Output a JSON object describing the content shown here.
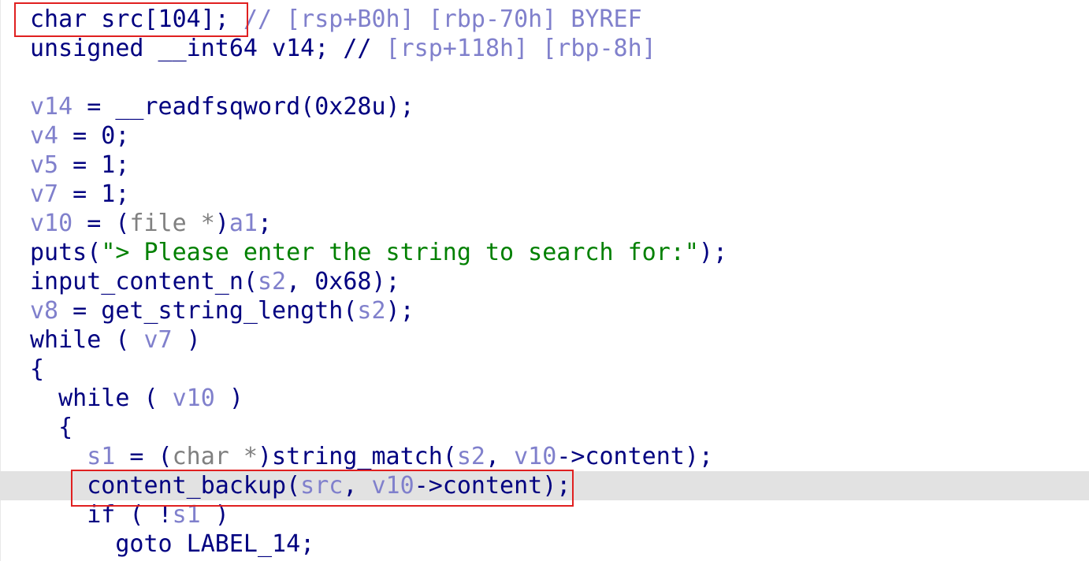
{
  "editor": {
    "lines": [
      [
        {
          "t": "char src[104]; ",
          "c": "kw"
        },
        {
          "t": "// [rsp+B0h] [rbp-70h] BYREF",
          "c": "cmt"
        }
      ],
      [
        {
          "t": "unsigned __int64 v14; ",
          "c": "kw"
        },
        {
          "t": "// ",
          "c": "kw"
        },
        {
          "t": "[rsp+118h] [rbp-8h]",
          "c": "cmt"
        }
      ],
      [],
      [
        {
          "t": "v14",
          "c": "var"
        },
        {
          "t": " = __readfsqword(0x28u);",
          "c": "plain"
        }
      ],
      [
        {
          "t": "v4",
          "c": "var"
        },
        {
          "t": " = 0;",
          "c": "plain"
        }
      ],
      [
        {
          "t": "v5",
          "c": "var"
        },
        {
          "t": " = 1;",
          "c": "plain"
        }
      ],
      [
        {
          "t": "v7",
          "c": "var"
        },
        {
          "t": " = 1;",
          "c": "plain"
        }
      ],
      [
        {
          "t": "v10",
          "c": "var"
        },
        {
          "t": " = (",
          "c": "plain"
        },
        {
          "t": "file *",
          "c": "type"
        },
        {
          "t": ")",
          "c": "plain"
        },
        {
          "t": "a1",
          "c": "var"
        },
        {
          "t": ";",
          "c": "plain"
        }
      ],
      [
        {
          "t": "puts(",
          "c": "plain"
        },
        {
          "t": "\"> Please enter the string to search for:\"",
          "c": "str"
        },
        {
          "t": ");",
          "c": "plain"
        }
      ],
      [
        {
          "t": "input_content_n(",
          "c": "plain"
        },
        {
          "t": "s2",
          "c": "var"
        },
        {
          "t": ", 0x68);",
          "c": "plain"
        }
      ],
      [
        {
          "t": "v8",
          "c": "var"
        },
        {
          "t": " = get_string_length(",
          "c": "plain"
        },
        {
          "t": "s2",
          "c": "var"
        },
        {
          "t": ");",
          "c": "plain"
        }
      ],
      [
        {
          "t": "while ( ",
          "c": "plain"
        },
        {
          "t": "v7",
          "c": "var"
        },
        {
          "t": " )",
          "c": "plain"
        }
      ],
      [
        {
          "t": "{",
          "c": "plain"
        }
      ],
      [
        {
          "t": "  while ( ",
          "c": "plain"
        },
        {
          "t": "v10",
          "c": "var"
        },
        {
          "t": " )",
          "c": "plain"
        }
      ],
      [
        {
          "t": "  {",
          "c": "plain"
        }
      ],
      [
        {
          "t": "    ",
          "c": "plain"
        },
        {
          "t": "s1",
          "c": "var"
        },
        {
          "t": " = (",
          "c": "plain"
        },
        {
          "t": "char *",
          "c": "type"
        },
        {
          "t": ")string_match(",
          "c": "plain"
        },
        {
          "t": "s2",
          "c": "var"
        },
        {
          "t": ", ",
          "c": "plain"
        },
        {
          "t": "v10",
          "c": "var"
        },
        {
          "t": "->content);",
          "c": "plain"
        }
      ],
      [
        {
          "t": "    content_backup(",
          "c": "plain"
        },
        {
          "t": "src",
          "c": "var"
        },
        {
          "t": ", ",
          "c": "plain"
        },
        {
          "t": "v10",
          "c": "var"
        },
        {
          "t": "->content);",
          "c": "plain"
        }
      ],
      [
        {
          "t": "    if ( !",
          "c": "plain"
        },
        {
          "t": "s1",
          "c": "var"
        },
        {
          "t": " )",
          "c": "plain"
        }
      ],
      [
        {
          "t": "      goto LABEL_14;",
          "c": "plain"
        }
      ]
    ],
    "highlighted_line": 16
  },
  "colors": {
    "keyword": "#000080",
    "variable": "#8080cc",
    "comment": "#8080cc",
    "string": "#008000",
    "type": "#808080",
    "highlight": "#e2e2e2",
    "annotation_box": "#e02020"
  }
}
